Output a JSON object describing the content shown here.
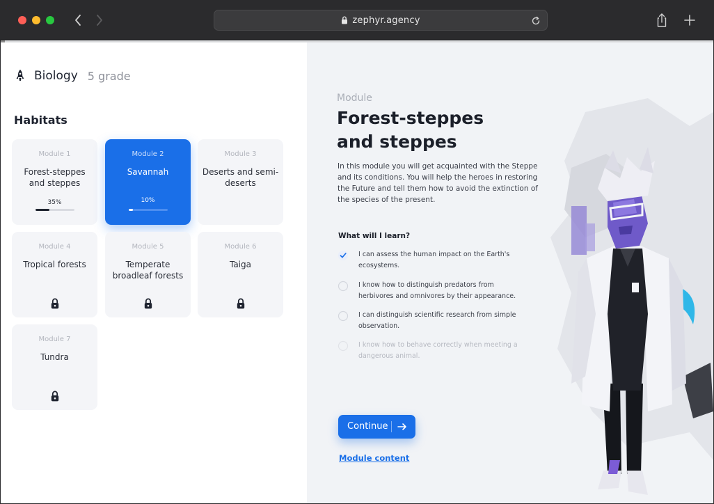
{
  "browser": {
    "url": "zephyr.agency"
  },
  "course": {
    "subject": "Biology",
    "grade": "5 grade",
    "section_title": "Habitats"
  },
  "modules": [
    {
      "label": "Module 1",
      "title": "Forest-steppes and steppes",
      "progress_text": "35%",
      "progress": 0.35,
      "state": "in-progress"
    },
    {
      "label": "Module 2",
      "title": "Savannah",
      "progress_text": "10%",
      "progress": 0.1,
      "state": "active"
    },
    {
      "label": "Module 3",
      "title": "Deserts and semi-deserts",
      "state": "available"
    },
    {
      "label": "Module 4",
      "title": "Tropical forests",
      "state": "locked"
    },
    {
      "label": "Module 5",
      "title": "Temperate broadleaf forests",
      "state": "locked"
    },
    {
      "label": "Module 6",
      "title": "Taiga",
      "state": "locked"
    },
    {
      "label": "Module 7",
      "title": "Tundra",
      "state": "locked"
    }
  ],
  "detail": {
    "kicker": "Module",
    "title": "Forest-steppes and steppes",
    "description": "In this module you will get acquainted with the Steppe and its conditions. You will help the heroes in restoring the Future and tell them how to avoid the extinction of the species of the present.",
    "learn_title": "What will I learn?",
    "learn_items": [
      {
        "text": "I can assess the human impact on the Earth's ecosystems.",
        "checked": true
      },
      {
        "text": "I know how to distinguish predators from herbivores and omnivores by their appearance.",
        "checked": false
      },
      {
        "text": "I can distinguish scientific research from simple observation.",
        "checked": false
      },
      {
        "text": "I know how to behave correctly when meeting a dangerous animal.",
        "checked": false
      }
    ],
    "continue_label": "Continue",
    "module_content_link": "Module content"
  },
  "colors": {
    "accent": "#1a6fe8",
    "card_bg": "#f4f5f8",
    "panel_bg": "#f1f3f6"
  },
  "icons": [
    "rocket-icon",
    "lock-icon",
    "check-circle-icon",
    "arrow-right-icon",
    "share-icon",
    "plus-icon",
    "reload-icon",
    "padlock-icon"
  ]
}
